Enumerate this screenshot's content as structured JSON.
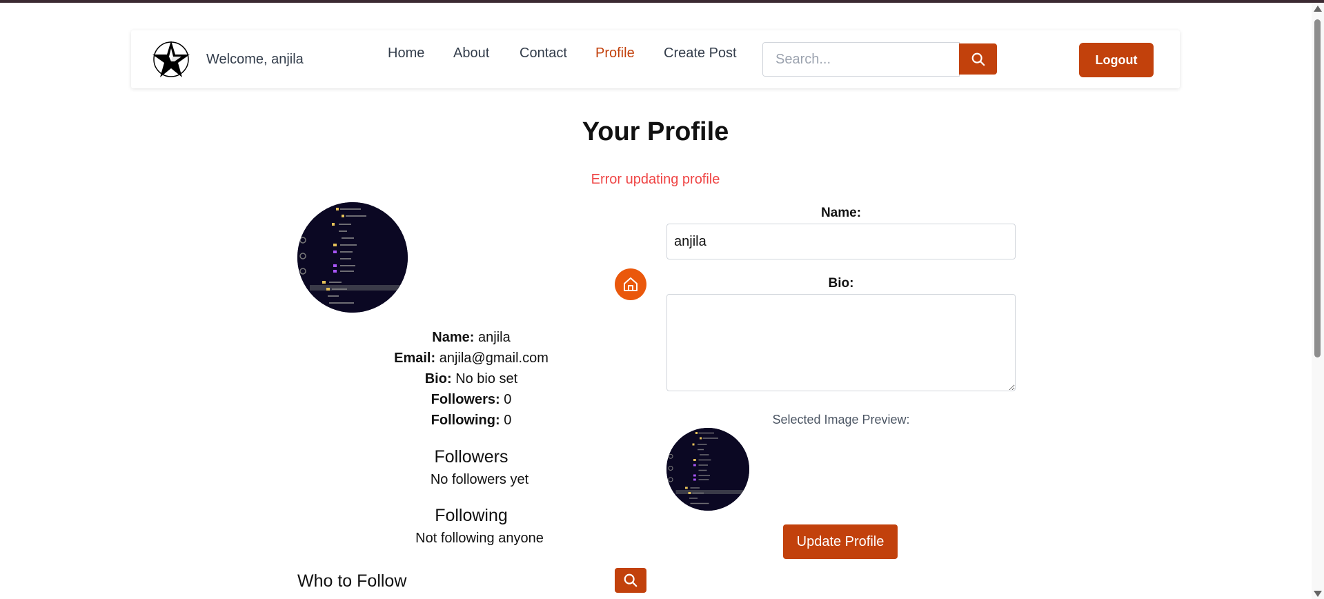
{
  "header": {
    "welcome": "Welcome, anjila",
    "nav": [
      "Home",
      "About",
      "Contact",
      "Profile",
      "Create Post"
    ],
    "active_nav": "Profile",
    "search_placeholder": "Search...",
    "logout": "Logout"
  },
  "profile": {
    "title": "Your Profile",
    "error": "Error updating profile",
    "info": {
      "name_label": "Name:",
      "name": "anjila",
      "email_label": "Email:",
      "email": "anjila@gmail.com",
      "bio_label": "Bio:",
      "bio": "No bio set",
      "followers_label": "Followers:",
      "followers": "0",
      "following_label": "Following:",
      "following": "0"
    },
    "followers_heading": "Followers",
    "followers_empty": "No followers yet",
    "following_heading": "Following",
    "following_empty": "Not following anyone",
    "who_to_follow": "Who to Follow"
  },
  "form": {
    "name_label": "Name:",
    "name_value": "anjila",
    "bio_label": "Bio:",
    "bio_value": "",
    "preview_label": "Selected Image Preview:",
    "update_button": "Update Profile"
  },
  "colors": {
    "accent": "#c2410c",
    "home_button": "#ea580c",
    "error": "#ef4444"
  }
}
